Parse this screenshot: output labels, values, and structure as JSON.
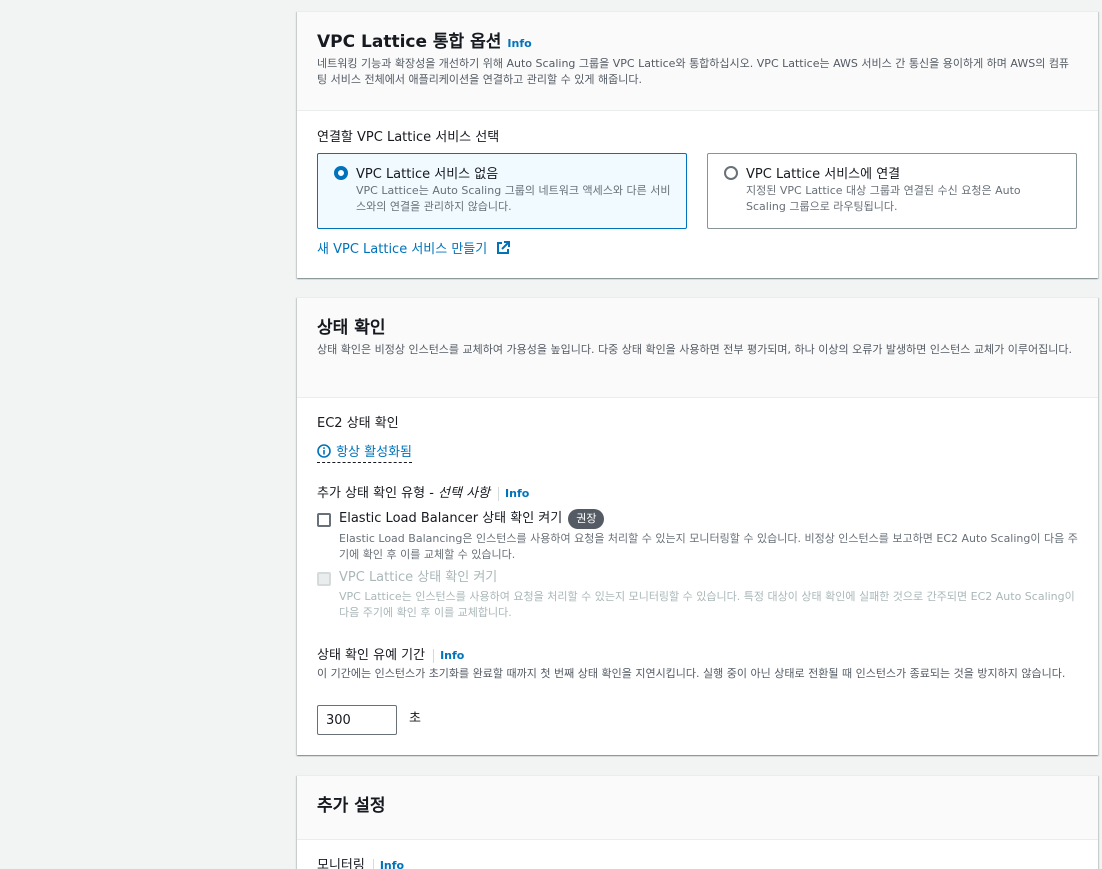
{
  "lattice": {
    "title": "VPC Lattice 통합 옵션",
    "info": "Info",
    "desc": "네트워킹 기능과 확장성을 개선하기 위해 Auto Scaling 그룹을 VPC Lattice와 통합하십시오. VPC Lattice는 AWS 서비스 간 통신을 용이하게 하며 AWS의 컴퓨팅 서비스 전체에서 애플리케이션을 연결하고 관리할 수 있게 해줍니다.",
    "select_label": "연결할 VPC Lattice 서비스 선택",
    "option_none_label": "VPC Lattice 서비스 없음",
    "option_none_desc": "VPC Lattice는 Auto Scaling 그룹의 네트워크 액세스와 다른 서비스와의 연결을 관리하지 않습니다.",
    "option_attach_label": "VPC Lattice 서비스에 연결",
    "option_attach_desc": "지정된 VPC Lattice 대상 그룹과 연결된 수신 요청은 Auto Scaling 그룹으로 라우팅됩니다.",
    "create_link": "새 VPC Lattice 서비스 만들기"
  },
  "health": {
    "title": "상태 확인",
    "desc": "상태 확인은 비정상 인스턴스를 교체하여 가용성을 높입니다. 다중 상태 확인을 사용하면 전부 평가되며, 하나 이상의 오류가 발생하면 인스턴스 교체가 이루어집니다.",
    "ec2_label": "EC2 상태 확인",
    "ec2_status": "항상 활성화됨",
    "additional_label": "추가 상태 확인 유형 - ",
    "additional_optional": "선택 사항",
    "info": "Info",
    "elb_label": "Elastic Load Balancer 상태 확인 켜기",
    "elb_badge": "권장",
    "elb_desc": "Elastic Load Balancing은 인스턴스를 사용하여 요청을 처리할 수 있는지 모니터링할 수 있습니다. 비정상 인스턴스를 보고하면 EC2 Auto Scaling이 다음 주기에 확인 후 이를 교체할 수 있습니다.",
    "lattice_label": "VPC Lattice 상태 확인 켜기",
    "lattice_desc": "VPC Lattice는 인스턴스를 사용하여 요청을 처리할 수 있는지 모니터링할 수 있습니다. 특정 대상이 상태 확인에 실패한 것으로 간주되면 EC2 Auto Scaling이 다음 주기에 확인 후 이를 교체합니다.",
    "grace_label": "상태 확인 유예 기간",
    "grace_desc": "이 기간에는 인스턴스가 초기화를 완료할 때까지 첫 번째 상태 확인을 지연시킵니다. 실행 중이 아닌 상태로 전환될 때 인스턴스가 종료되는 것을 방지하지 않습니다.",
    "grace_value": "300",
    "grace_unit": "초"
  },
  "additional": {
    "title": "추가 설정",
    "monitoring_label": "모니터링",
    "info": "Info"
  },
  "colors": {
    "link": "#0073bb",
    "background": "#f2f3f3"
  }
}
